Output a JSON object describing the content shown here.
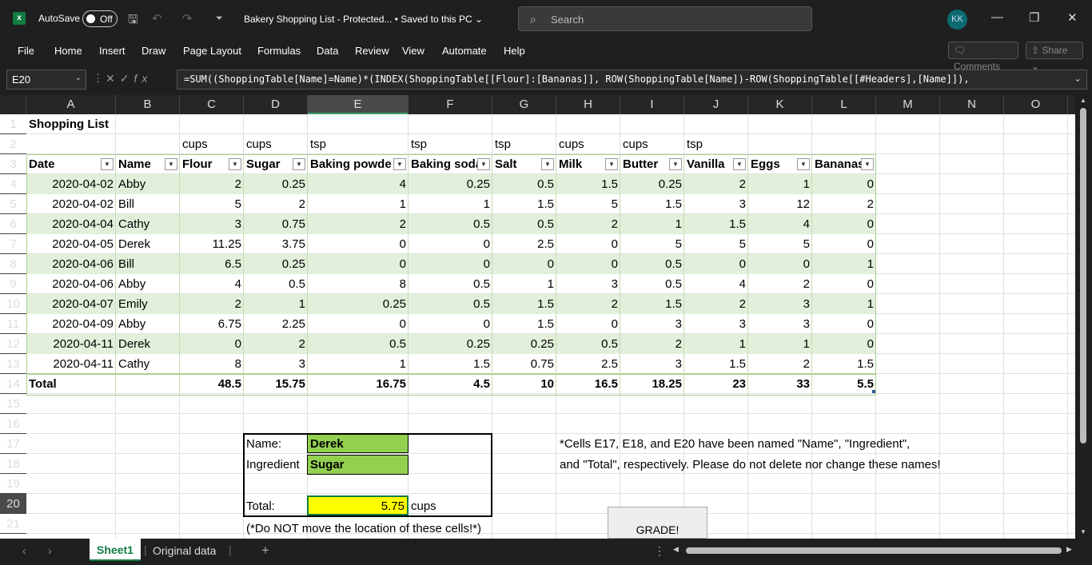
{
  "titlebar": {
    "autosave_label": "AutoSave",
    "autosave_state": "Off",
    "doc_title": "Bakery Shopping List  -  Protected...   •  Saved to this PC ⌄",
    "search_placeholder": "Search",
    "avatar_initials": "KK"
  },
  "menu": [
    "File",
    "Home",
    "Insert",
    "Draw",
    "Page Layout",
    "Formulas",
    "Data",
    "Review",
    "View",
    "Automate",
    "Help"
  ],
  "ribbon_buttons": {
    "comments": "Comments",
    "share": "Share"
  },
  "formula_bar": {
    "name_box": "E20",
    "formula": "=SUM((ShoppingTable[Name]=Name)*(INDEX(ShoppingTable[[Flour]:[Bananas]], ROW(ShoppingTable[Name])-ROW(ShoppingTable[[#Headers],[Name]]),"
  },
  "columns": [
    "A",
    "B",
    "C",
    "D",
    "E",
    "F",
    "G",
    "H",
    "I",
    "J",
    "K",
    "L",
    "M",
    "N",
    "O"
  ],
  "rows": [
    "1",
    "2",
    "3",
    "4",
    "5",
    "6",
    "7",
    "8",
    "9",
    "10",
    "11",
    "12",
    "13",
    "14",
    "15",
    "16",
    "17",
    "18",
    "19",
    "20",
    "21"
  ],
  "sheet": {
    "title": "Shopping List",
    "units": [
      "cups",
      "cups",
      "tsp",
      "tsp",
      "tsp",
      "cups",
      "cups",
      "tsp"
    ],
    "headers": [
      "Date",
      "Name",
      "Flour",
      "Sugar",
      "Baking powde",
      "Baking soda",
      "Salt",
      "Milk",
      "Butter",
      "Vanilla",
      "Eggs",
      "Bananas"
    ],
    "data": [
      [
        "2020-04-02",
        "Abby",
        "2",
        "0.25",
        "4",
        "0.25",
        "0.5",
        "1.5",
        "0.25",
        "2",
        "1",
        "0"
      ],
      [
        "2020-04-02",
        "Bill",
        "5",
        "2",
        "1",
        "1",
        "1.5",
        "5",
        "1.5",
        "3",
        "12",
        "2"
      ],
      [
        "2020-04-04",
        "Cathy",
        "3",
        "0.75",
        "2",
        "0.5",
        "0.5",
        "2",
        "1",
        "1.5",
        "4",
        "0"
      ],
      [
        "2020-04-05",
        "Derek",
        "11.25",
        "3.75",
        "0",
        "0",
        "2.5",
        "0",
        "5",
        "5",
        "5",
        "0"
      ],
      [
        "2020-04-06",
        "Bill",
        "6.5",
        "0.25",
        "0",
        "0",
        "0",
        "0",
        "0.5",
        "0",
        "0",
        "1"
      ],
      [
        "2020-04-06",
        "Abby",
        "4",
        "0.5",
        "8",
        "0.5",
        "1",
        "3",
        "0.5",
        "4",
        "2",
        "0"
      ],
      [
        "2020-04-07",
        "Emily",
        "2",
        "1",
        "0.25",
        "0.5",
        "1.5",
        "2",
        "1.5",
        "2",
        "3",
        "1"
      ],
      [
        "2020-04-09",
        "Abby",
        "6.75",
        "2.25",
        "0",
        "0",
        "1.5",
        "0",
        "3",
        "3",
        "3",
        "0"
      ],
      [
        "2020-04-11",
        "Derek",
        "0",
        "2",
        "0.5",
        "0.25",
        "0.25",
        "0.5",
        "2",
        "1",
        "1",
        "0"
      ],
      [
        "2020-04-11",
        "Cathy",
        "8",
        "3",
        "1",
        "1.5",
        "0.75",
        "2.5",
        "3",
        "1.5",
        "2",
        "1.5"
      ]
    ],
    "total_label": "Total",
    "totals": [
      "48.5",
      "15.75",
      "16.75",
      "4.5",
      "10",
      "16.5",
      "18.25",
      "23",
      "33",
      "5.5"
    ],
    "lookup": {
      "name_label": "Name:",
      "name_value": "Derek",
      "ingredient_label": "Ingredient",
      "ingredient_value": "Sugar",
      "total_label": "Total:",
      "total_value": "5.75",
      "total_unit": "cups",
      "note": "(*Do NOT move the location of these cells!*)"
    },
    "notice_line1": "*Cells E17, E18, and E20 have been named \"Name\", \"Ingredient\",",
    "notice_line2": "and \"Total\", respectively.  Please do not delete nor change these names!",
    "grade_button": "GRADE!"
  },
  "tabs": {
    "active": "Sheet1",
    "other": "Original data"
  }
}
